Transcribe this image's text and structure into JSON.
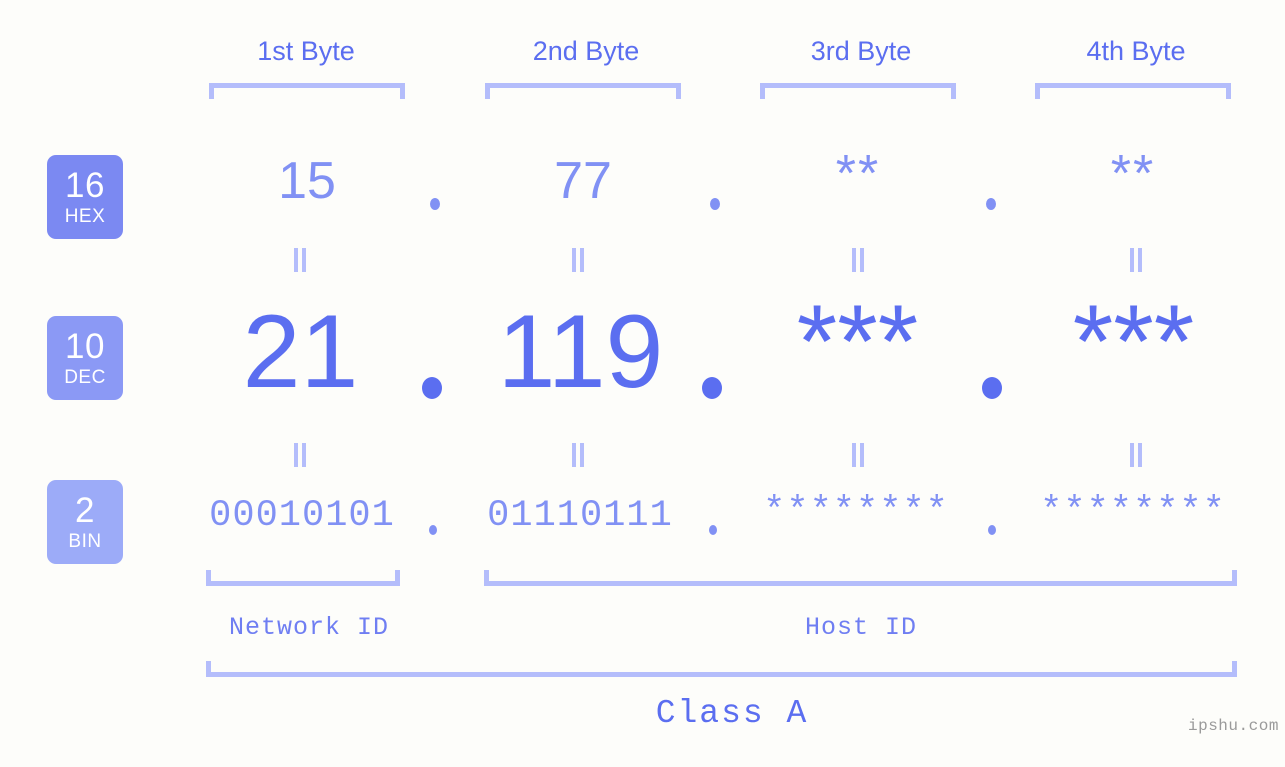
{
  "meta": {
    "background_color": "#fdfdfa",
    "accent_color": "#5b6ef0",
    "accent_light_color": "#8191f4",
    "bracket_color": "#b4bdfb",
    "watermark": "ipshu.com"
  },
  "byte_headers": [
    {
      "label": "1st Byte"
    },
    {
      "label": "2nd Byte"
    },
    {
      "label": "3rd Byte"
    },
    {
      "label": "4th Byte"
    }
  ],
  "radix_badges": [
    {
      "number": "16",
      "system": "HEX",
      "color": "#7b89f2"
    },
    {
      "number": "10",
      "system": "DEC",
      "color": "#8b99f5"
    },
    {
      "number": "2",
      "system": "BIN",
      "color": "#9cabf8"
    }
  ],
  "rows": {
    "hex": {
      "name": "HEX",
      "separator": ".",
      "values": [
        "15",
        "77",
        "**",
        "**"
      ]
    },
    "dec": {
      "name": "DEC",
      "separator": ".",
      "values": [
        "21",
        "119",
        "***",
        "***"
      ]
    },
    "bin": {
      "name": "BIN",
      "separator": ".",
      "values": [
        "00010101",
        "01110111",
        "********",
        "********"
      ]
    }
  },
  "equality_marks": {
    "glyph": "||",
    "count_per_gap": 4
  },
  "footer": {
    "network_id_label": "Network ID",
    "host_id_label": "Host ID",
    "class_label": "Class A"
  }
}
